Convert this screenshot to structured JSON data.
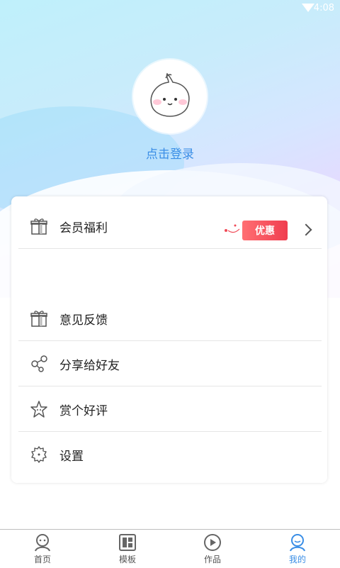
{
  "status_bar": {
    "time": "4:08"
  },
  "profile": {
    "login_label": "点击登录"
  },
  "menu": {
    "vip": {
      "label": "会员福利",
      "badge": "优惠"
    },
    "items": [
      {
        "label": "意见反馈",
        "icon": "gift-icon"
      },
      {
        "label": "分享给好友",
        "icon": "share-icon"
      },
      {
        "label": "赏个好评",
        "icon": "star-icon"
      },
      {
        "label": "设置",
        "icon": "gear-icon"
      }
    ]
  },
  "bottom_nav": [
    {
      "label": "首页",
      "icon": "user-home-icon",
      "active": false
    },
    {
      "label": "模板",
      "icon": "template-icon",
      "active": false
    },
    {
      "label": "作品",
      "icon": "play-icon",
      "active": false
    },
    {
      "label": "我的",
      "icon": "profile-icon",
      "active": true
    }
  ],
  "colors": {
    "accent": "#3a8ee6",
    "badge": "#f04a57"
  }
}
